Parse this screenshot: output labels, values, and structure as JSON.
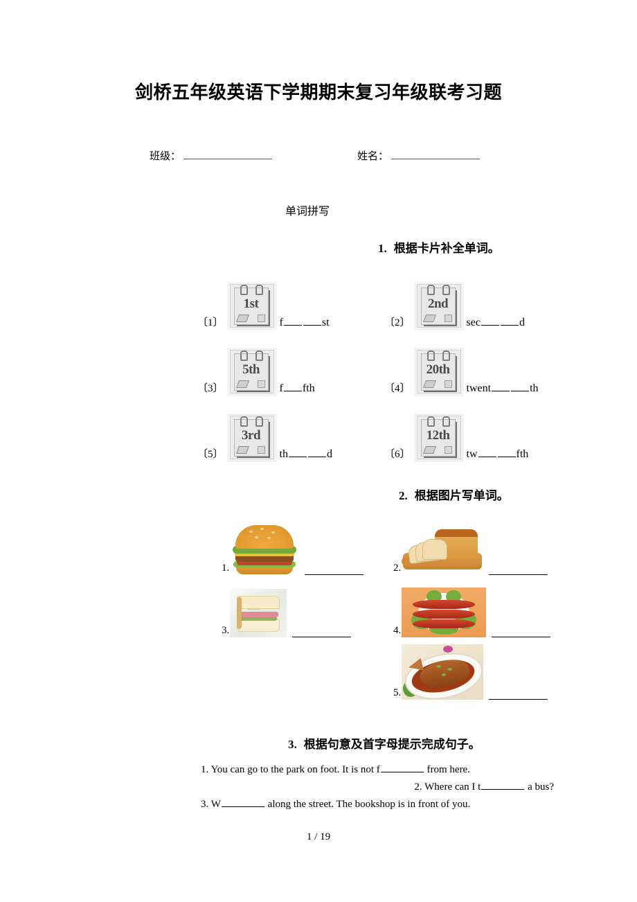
{
  "document": {
    "title": "剑桥五年级英语下学期期末复习年级联考习题",
    "footer_page": "1 / 19"
  },
  "fields": {
    "class_label": "班级：",
    "name_label": "姓名："
  },
  "section": {
    "title": "单词拼写"
  },
  "questions": [
    {
      "number": "1.",
      "heading": "根据卡片补全单词。",
      "items": [
        {
          "index": "〔1〕",
          "card": "1st",
          "answer_prefix": "f",
          "answer_mid": "",
          "answer_suffix": "st",
          "blanks": 2
        },
        {
          "index": "〔2〕",
          "card": "2nd",
          "answer_prefix": "sec",
          "answer_mid": "",
          "answer_suffix": "d",
          "blanks": 2
        },
        {
          "index": "〔3〕",
          "card": "5th",
          "answer_prefix": "f",
          "answer_mid": "",
          "answer_suffix": "fth",
          "blanks": 1
        },
        {
          "index": "〔4〕",
          "card": "20th",
          "answer_prefix": "twent",
          "answer_mid": "",
          "answer_suffix": "th",
          "blanks": 2
        },
        {
          "index": "〔5〕",
          "card": "3rd",
          "answer_prefix": "th",
          "answer_mid": "",
          "answer_suffix": "d",
          "blanks": 2
        },
        {
          "index": "〔6〕",
          "card": "12th",
          "answer_prefix": "tw",
          "answer_mid": "",
          "answer_suffix": "fth",
          "blanks": 2
        }
      ]
    },
    {
      "number": "2.",
      "heading": "根据图片写单词。",
      "items": [
        {
          "index": "1.",
          "picture": "hamburger-photo"
        },
        {
          "index": "2.",
          "picture": "bread-loaf-photo"
        },
        {
          "index": "3.",
          "picture": "sandwich-photo"
        },
        {
          "index": "4.",
          "picture": "sausages-photo"
        },
        {
          "index": "5.",
          "picture": "fish-dish-photo"
        }
      ]
    },
    {
      "number": "3.",
      "heading": "根据句意及首字母提示完成句子。",
      "sentences": [
        {
          "num": "1.",
          "before": "You can go to the park on foot. It is not f",
          "after": " from here."
        },
        {
          "num": "2.",
          "before": "Where can I t",
          "after": " a bus?"
        },
        {
          "num": "3.",
          "before": "W",
          "after": " along the street. The bookshop is in front of you."
        }
      ]
    }
  ]
}
